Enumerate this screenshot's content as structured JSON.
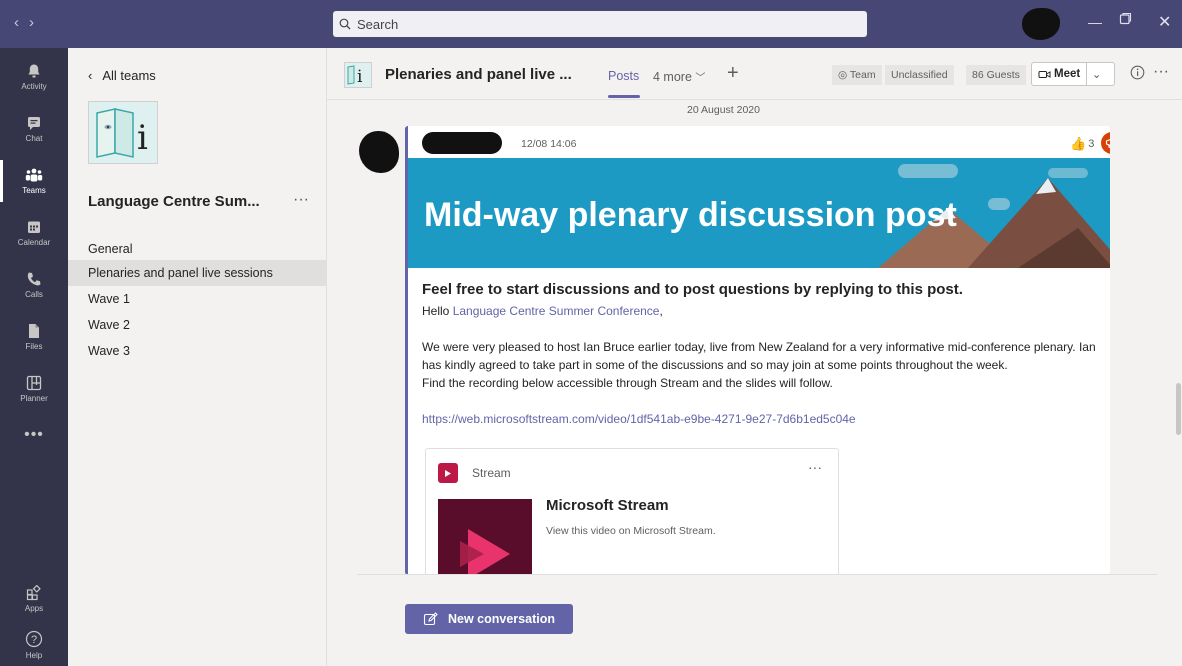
{
  "titlebar": {
    "search_placeholder": "Search"
  },
  "rail": [
    {
      "label": "Activity",
      "icon": "bell-icon"
    },
    {
      "label": "Chat",
      "icon": "chat-icon"
    },
    {
      "label": "Teams",
      "icon": "teams-icon"
    },
    {
      "label": "Calendar",
      "icon": "calendar-icon"
    },
    {
      "label": "Calls",
      "icon": "phone-icon"
    },
    {
      "label": "Files",
      "icon": "file-icon"
    },
    {
      "label": "Planner",
      "icon": "planner-icon"
    },
    {
      "label": "Apps",
      "icon": "apps-icon"
    },
    {
      "label": "Help",
      "icon": "help-icon"
    }
  ],
  "teampanel": {
    "back_label": "All teams",
    "team_name": "Language Centre Sum...",
    "channels": [
      "General",
      "Plenaries and panel live sessions",
      "Wave 1",
      "Wave 2",
      "Wave 3"
    ]
  },
  "header": {
    "channel_title": "Plenaries and panel live ...",
    "tab_posts": "Posts",
    "tab_more": "4 more",
    "team_label": "Team",
    "classification": "Unclassified",
    "guests": "86 Guests",
    "meet_label": "Meet"
  },
  "feed": {
    "date_separator": "20 August 2020",
    "post": {
      "time": "12/08 14:06",
      "like_count": "3",
      "banner_title": "Mid-way plenary discussion post",
      "subject": "Feel free to start discussions and to post questions by replying to this post.",
      "greeting_prefix": "Hello ",
      "greeting_link": "Language Centre Summer Conference",
      "greeting_suffix": ",",
      "paragraph1": "We were very pleased to host Ian Bruce earlier today, live from New Zealand for a very informative mid-conference plenary. Ian has kindly agreed to take part in some of the discussions and so may join at some points throughout the week.",
      "paragraph2": "Find the recording below accessible through Stream and the slides will follow.",
      "url": "https://web.microsoftstream.com/video/1df541ab-e9be-4271-9e27-7d6b1ed5c04e",
      "card": {
        "brand": "Stream",
        "title": "Microsoft Stream",
        "description": "View this video on Microsoft Stream."
      }
    },
    "new_conversation_label": "New conversation"
  },
  "colors": {
    "titlebar": "#464775",
    "rail": "#33344a",
    "accent": "#6264a7",
    "banner": "#1d9ac4",
    "stream_brand": "#bc1948"
  }
}
